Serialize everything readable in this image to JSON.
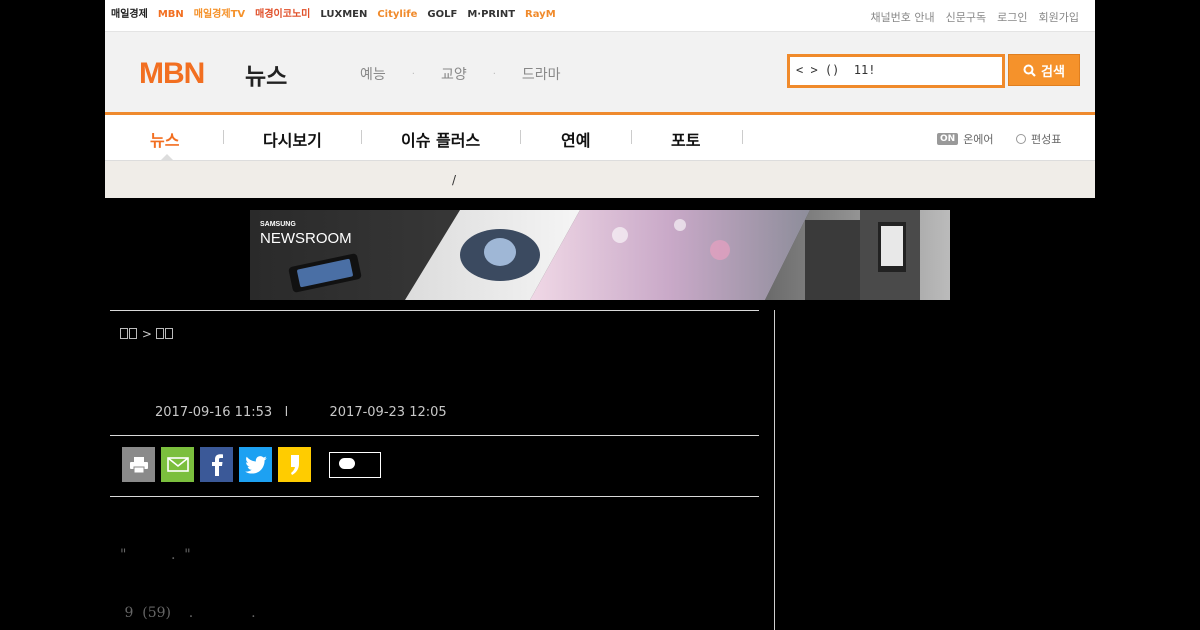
{
  "brands": [
    {
      "label": "매일경제",
      "color": "#222222"
    },
    {
      "label": "MBN",
      "color": "#f26f21"
    },
    {
      "label": "매일경제TV",
      "color": "#f5922b"
    },
    {
      "label": "매경이코노미",
      "color": "#e0502a"
    },
    {
      "label": "LUXMEN",
      "color": "#333333"
    },
    {
      "label": "Citylife",
      "color": "#f08a2b"
    },
    {
      "label": "GOLF",
      "color": "#333333"
    },
    {
      "label": "M·PRINT",
      "color": "#333333"
    },
    {
      "label": "RayM",
      "color": "#f08a2b"
    }
  ],
  "toplinks": [
    "채널번호 안내",
    "신문구독",
    "로그인",
    "회원가입"
  ],
  "header": {
    "logo": "MBN",
    "section": "뉴스",
    "subnav": [
      "예능",
      "교양",
      "드라마"
    ],
    "subnav_sep": "·",
    "search_value": "< > ()  11!",
    "search_button": "검색"
  },
  "nav": {
    "items": [
      "뉴스",
      "다시보기",
      "이슈 플러스",
      "연예",
      "포토"
    ],
    "onair_badge": "ON",
    "onair": "온에어",
    "schedule": "편성표"
  },
  "strip": {
    "slash": "/"
  },
  "banner": {
    "brand_small": "SAMSUNG",
    "brand_big": "NEWSROOM"
  },
  "article": {
    "breadcrumb_sep": ">",
    "posted": "2017-09-16 11:53",
    "date_sep": "l",
    "updated": "2017-09-23 12:05",
    "body_line1": "\"          .  \"",
    "body_line2": " 9  (59)    .             ."
  },
  "share": {
    "buttons": [
      {
        "name": "print",
        "color": "#8a8a8a"
      },
      {
        "name": "email",
        "color": "#7bbf3d"
      },
      {
        "name": "facebook",
        "color": "#3b5998"
      },
      {
        "name": "twitter",
        "color": "#1da1f2"
      },
      {
        "name": "kakaostory",
        "color": "#ffcc00"
      }
    ]
  },
  "colors": {
    "accent": "#f26f21",
    "search_border": "#f08a2b"
  }
}
